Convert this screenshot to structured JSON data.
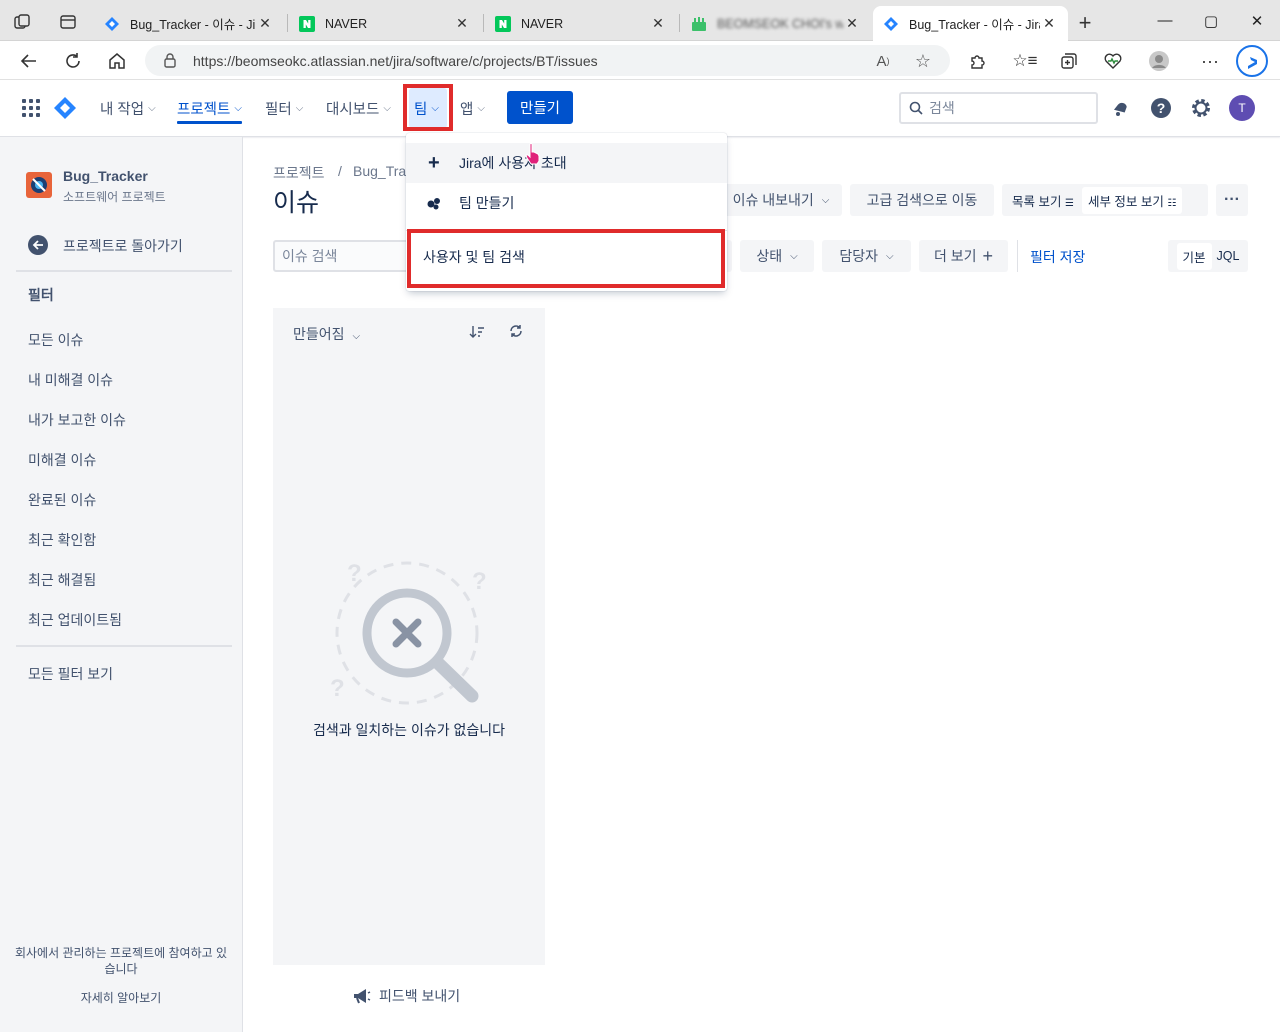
{
  "browser": {
    "tabs": [
      {
        "title": "Bug_Tracker - 이슈 - Jira",
        "icon": "jira-icon"
      },
      {
        "title": "NAVER",
        "icon": "naver-icon"
      },
      {
        "title": "NAVER",
        "icon": "naver-icon"
      },
      {
        "title": "BEOMSEOK CHOI's wait",
        "icon": "wait-icon"
      },
      {
        "title": "Bug_Tracker - 이슈 - Jira",
        "icon": "jira-icon"
      }
    ],
    "url": "https://beomseokc.atlassian.net/jira/software/c/projects/BT/issues"
  },
  "topnav": {
    "my_work": "내 작업",
    "projects": "프로젝트",
    "filters": "필터",
    "dashboards": "대시보드",
    "teams": "팀",
    "apps": "앱",
    "create": "만들기",
    "search_placeholder": "검색",
    "avatar_initial": "T"
  },
  "team_menu": {
    "items": [
      {
        "label": "Jira에 사용자 초대",
        "icon": "plus-icon"
      },
      {
        "label": "팀 만들기",
        "icon": "team-icon"
      },
      {
        "label": "사용자 및 팀 검색",
        "icon": ""
      }
    ]
  },
  "sidebar": {
    "project_name": "Bug_Tracker",
    "project_type": "소프트웨어 프로젝트",
    "back_label": "프로젝트로 돌아가기",
    "section_title": "필터",
    "items": [
      "모든 이슈",
      "내 미해결 이슈",
      "내가 보고한 이슈",
      "미해결 이슈",
      "완료된 이슈",
      "최근 확인함",
      "최근 해결됨",
      "최근 업데이트됨"
    ],
    "all_filters": "모든 필터 보기",
    "footer_text": "회사에서 관리하는 프로젝트에 참여하고 있습니다",
    "learn_more": "자세히 알아보기"
  },
  "main": {
    "breadcrumb_root": "프로젝트",
    "breadcrumb_sep": "/",
    "breadcrumb_project": "Bug_Trac",
    "page_title": "이슈",
    "export_label": "이슈 내보내기",
    "advanced_search": "고급 검색으로 이동",
    "list_view": "목록 보기",
    "detail_view": "세부 정보 보기",
    "search_placeholder": "이슈 검색",
    "filter_status": "상태",
    "filter_assignee": "담당자",
    "filter_more": "더 보기",
    "save_filter": "필터 저장",
    "mode_basic": "기본",
    "mode_jql": "JQL",
    "sort_label": "만들어짐",
    "empty_text": "검색과 일치하는 이슈가 없습니다",
    "feedback": "피드백 보내기"
  },
  "colors": {
    "primary": "#0052cc",
    "highlight": "#e02b2b",
    "sidebar_bg": "#f4f5f7"
  }
}
